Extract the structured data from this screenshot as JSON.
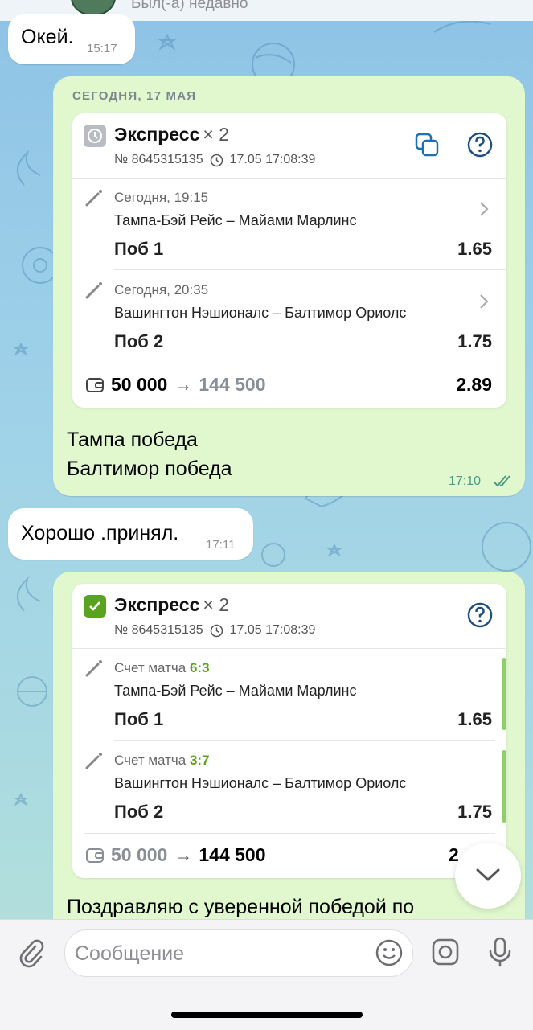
{
  "header": {
    "status": "Был(-а) недавно"
  },
  "messages": {
    "m1": {
      "text": "Окей.",
      "time": "15:17"
    },
    "m2_date": "СЕГОДНЯ, 17 МАЯ",
    "m2_text_line1": "Тампа победа",
    "m2_text_line2": "Балтимор победа",
    "m2_time": "17:10",
    "m3": {
      "text": "Хорошо .принял.",
      "time": "17:11"
    },
    "m4_text": "Поздравляю с уверенной победой по"
  },
  "bet_card_1": {
    "status": "pending",
    "title": "Экспресс",
    "multiplier": "× 2",
    "number": "№ 8645315135",
    "datetime": "17.05 17:08:39",
    "events": [
      {
        "date": "Сегодня, 19:15",
        "teams": "Тампа-Бэй Рейс – Майами Марлинс",
        "pick": "Поб 1",
        "odds": "1.65"
      },
      {
        "date": "Сегодня, 20:35",
        "teams": "Вашингтон Нэшионалс – Балтимор Ориолс",
        "pick": "Поб 2",
        "odds": "1.75"
      }
    ],
    "stake": "50 000",
    "payout": "144 500",
    "total_odds": "2.89"
  },
  "bet_card_2": {
    "status": "won",
    "title": "Экспресс",
    "multiplier": "× 2",
    "number": "№ 8645315135",
    "datetime": "17.05 17:08:39",
    "score_label": "Счет матча",
    "events": [
      {
        "score": "6:3",
        "teams": "Тампа-Бэй Рейс – Майами Марлинс",
        "pick": "Поб 1",
        "odds": "1.65"
      },
      {
        "score": "3:7",
        "teams": "Вашингтон Нэшионалс – Балтимор Ориолс",
        "pick": "Поб 2",
        "odds": "1.75"
      }
    ],
    "stake": "50 000",
    "payout": "144 500",
    "total_odds_partial": "2"
  },
  "input": {
    "placeholder": "Сообщение"
  },
  "colors": {
    "outgoing_bubble": "#e1f8cf",
    "won_green": "#5aa31e",
    "accent_blue": "#1f6fb5"
  }
}
